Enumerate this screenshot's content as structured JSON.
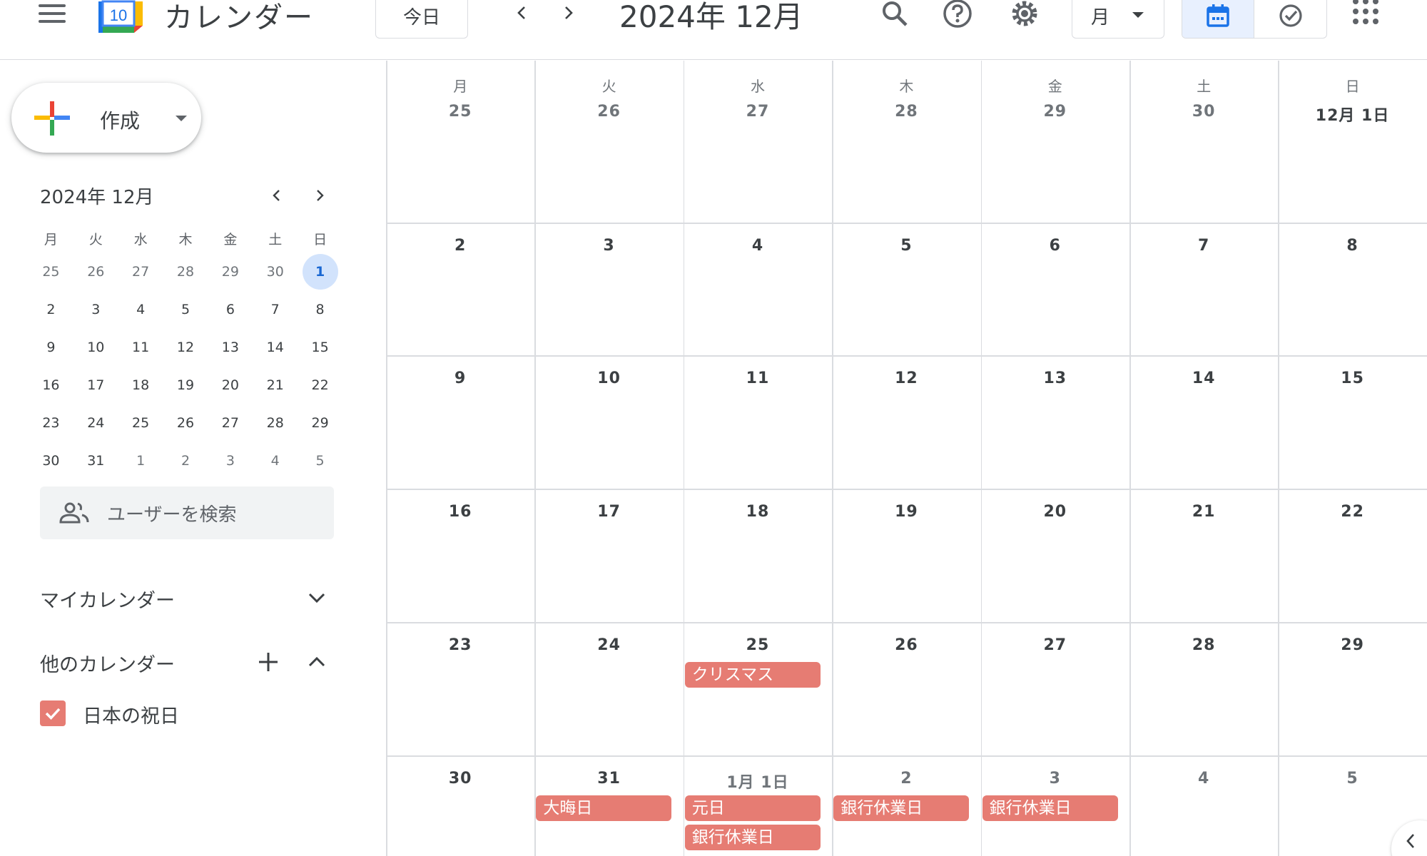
{
  "header": {
    "app_name": "カレンダー",
    "logo_day": "10",
    "today_label": "今日",
    "period_title": "2024年 12月",
    "view_label": "月"
  },
  "sidebar": {
    "create_label": "作成",
    "mini_calendar": {
      "title": "2024年 12月",
      "weekdays": [
        "月",
        "火",
        "水",
        "木",
        "金",
        "土",
        "日"
      ],
      "weeks": [
        [
          "25",
          "26",
          "27",
          "28",
          "29",
          "30",
          "1"
        ],
        [
          "2",
          "3",
          "4",
          "5",
          "6",
          "7",
          "8"
        ],
        [
          "9",
          "10",
          "11",
          "12",
          "13",
          "14",
          "15"
        ],
        [
          "16",
          "17",
          "18",
          "19",
          "20",
          "21",
          "22"
        ],
        [
          "23",
          "24",
          "25",
          "26",
          "27",
          "28",
          "29"
        ],
        [
          "30",
          "31",
          "1",
          "2",
          "3",
          "4",
          "5"
        ]
      ],
      "selected": "1"
    },
    "people_search_placeholder": "ユーザーを検索",
    "my_calendars_label": "マイカレンダー",
    "other_calendars_label": "他のカレンダー",
    "other_calendars": [
      {
        "name": "日本の祝日",
        "checked": true,
        "color": "#e67c73"
      }
    ]
  },
  "month": {
    "weekdays": [
      "月",
      "火",
      "水",
      "木",
      "金",
      "土",
      "日"
    ],
    "weeks": [
      [
        "25",
        "26",
        "27",
        "28",
        "29",
        "30",
        "12月 1日"
      ],
      [
        "2",
        "3",
        "4",
        "5",
        "6",
        "7",
        "8"
      ],
      [
        "9",
        "10",
        "11",
        "12",
        "13",
        "14",
        "15"
      ],
      [
        "16",
        "17",
        "18",
        "19",
        "20",
        "21",
        "22"
      ],
      [
        "23",
        "24",
        "25",
        "26",
        "27",
        "28",
        "29"
      ],
      [
        "30",
        "31",
        "1月 1日",
        "2",
        "3",
        "4",
        "5"
      ]
    ],
    "events": [
      {
        "week": 4,
        "day": 2,
        "slot": 0,
        "title": "クリスマス"
      },
      {
        "week": 5,
        "day": 1,
        "slot": 0,
        "title": "大晦日"
      },
      {
        "week": 5,
        "day": 2,
        "slot": 0,
        "title": "元日"
      },
      {
        "week": 5,
        "day": 2,
        "slot": 1,
        "title": "銀行休業日"
      },
      {
        "week": 5,
        "day": 3,
        "slot": 0,
        "title": "銀行休業日"
      },
      {
        "week": 5,
        "day": 4,
        "slot": 0,
        "title": "銀行休業日"
      }
    ]
  },
  "colors": {
    "accent": "#1a73e8",
    "event": "#e67c73",
    "selected_day_bg": "#d2e3fc"
  }
}
